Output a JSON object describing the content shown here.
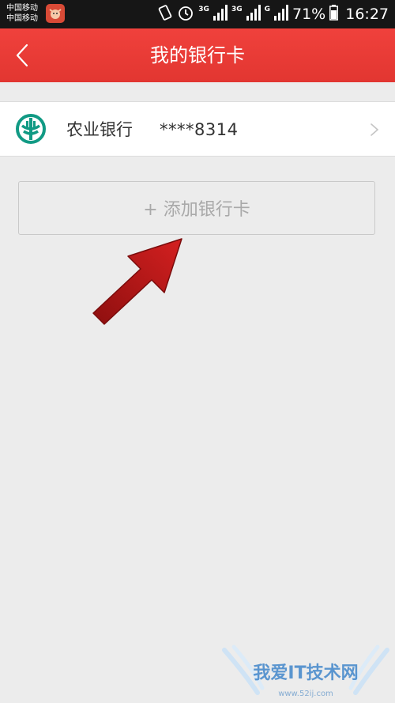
{
  "status_bar": {
    "carrier_line1": "中国移动",
    "carrier_line2": "中国移动",
    "net1": "3G",
    "net2": "3G",
    "net3": "G",
    "battery": "71%",
    "time": "16:27"
  },
  "header": {
    "title": "我的银行卡",
    "background_color": "#e83a35"
  },
  "bank_card": {
    "bank_name": "农业银行",
    "card_number": "****8314",
    "logo_color": "#119a84"
  },
  "add_card": {
    "label": "+ 添加银行卡"
  },
  "watermark": {
    "text": "我爱IT技术网",
    "url": "www.52ij.com"
  },
  "icons": {
    "back": "chevron-left-icon",
    "row_chevron": "chevron-right-icon",
    "bank_logo": "agricultural-bank-logo"
  },
  "accent_colors": {
    "annotation_arrow": "#c41a1a"
  }
}
